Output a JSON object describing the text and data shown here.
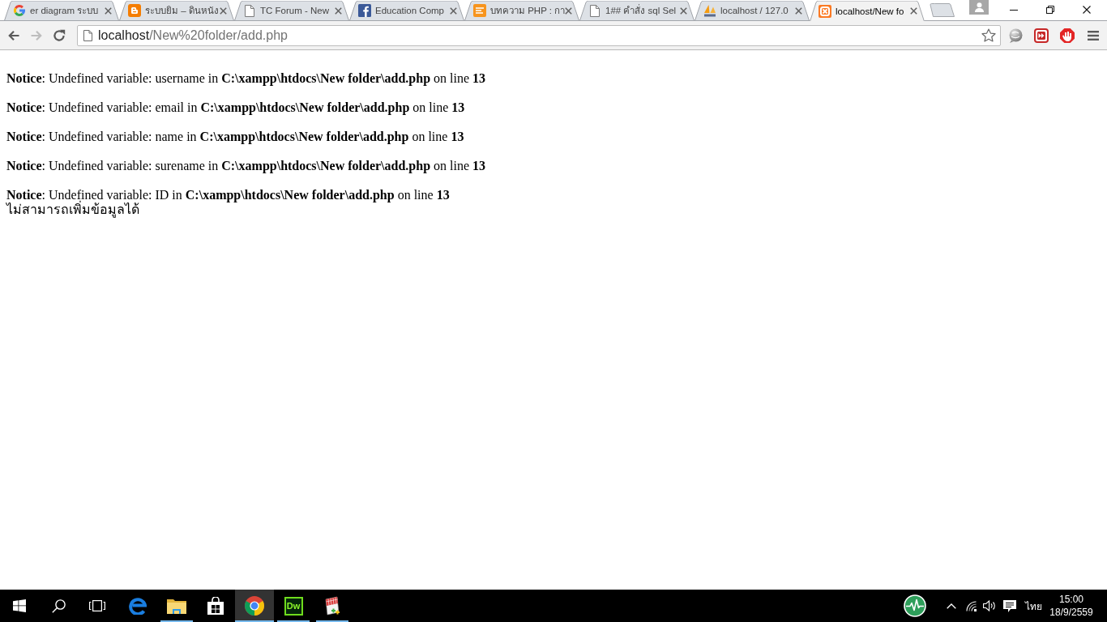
{
  "browser": {
    "tabs": [
      {
        "kind": "google",
        "title": "er diagram ระบบ",
        "selected": false
      },
      {
        "kind": "blogger",
        "title": "ระบบยิม – ดินหนัง",
        "selected": false
      },
      {
        "kind": "page",
        "title": "TC Forum - New",
        "selected": false
      },
      {
        "kind": "facebook",
        "title": "Education Comp",
        "selected": false
      },
      {
        "kind": "tips",
        "title": "บทความ PHP : กา",
        "selected": false
      },
      {
        "kind": "page",
        "title": "1## คำสั่ง sql Sel",
        "selected": false
      },
      {
        "kind": "pma",
        "title": "localhost / 127.0",
        "selected": false
      },
      {
        "kind": "xampp",
        "title": "localhost/New fo",
        "selected": true
      }
    ],
    "navigation": [
      {
        "kind": "back",
        "disabled": false
      },
      {
        "kind": "forward",
        "disabled": true
      },
      {
        "kind": "reload",
        "disabled": false
      }
    ],
    "address_bar": {
      "host": "localhost",
      "path": "/New%20folder/add.php"
    }
  },
  "page": {
    "notices": [
      "**Notice**: Undefined variable: username in **C:\\xampp\\htdocs\\New folder\\add.php** on line **13**",
      "**Notice**: Undefined variable: email in **C:\\xampp\\htdocs\\New folder\\add.php** on line **13**",
      "**Notice**: Undefined variable: name in **C:\\xampp\\htdocs\\New folder\\add.php** on line **13**",
      "**Notice**: Undefined variable: surename in **C:\\xampp\\htdocs\\New folder\\add.php** on line **13**",
      "**Notice**: Undefined variable: ID in **C:\\xampp\\htdocs\\New folder\\add.php** on line **13**"
    ],
    "message": "ไม่สามารถเพิ่มข้อมูลได้"
  },
  "taskbar": {
    "buttons": [
      {
        "kind": "start",
        "running": false,
        "selected": false
      },
      {
        "kind": "search",
        "running": false,
        "selected": false
      },
      {
        "kind": "task_view",
        "running": false,
        "selected": false
      },
      {
        "kind": "edge",
        "running": false,
        "selected": false
      },
      {
        "kind": "explorer",
        "running": true,
        "selected": false
      },
      {
        "kind": "store",
        "running": false,
        "selected": false
      },
      {
        "kind": "chrome",
        "running": true,
        "selected": true
      },
      {
        "kind": "dreamweaver",
        "label": "Dw",
        "running": true,
        "selected": false
      },
      {
        "kind": "notepad",
        "running": true,
        "selected": false
      }
    ],
    "tray": {
      "language": "ไทย",
      "time": "15:00",
      "date": "18/9/2559"
    }
  }
}
